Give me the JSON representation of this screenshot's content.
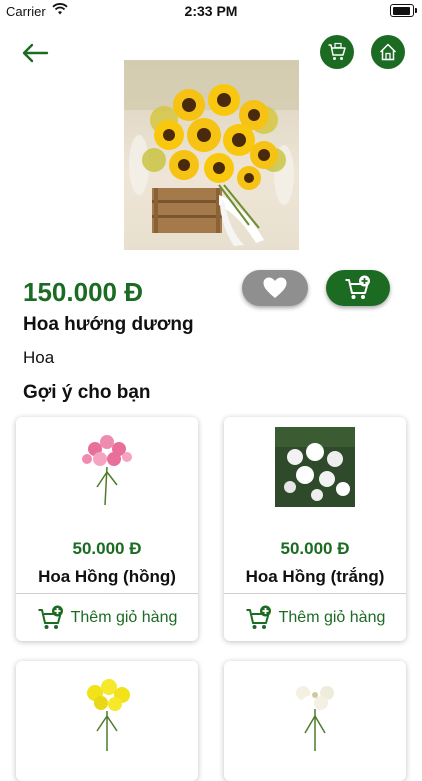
{
  "status_bar": {
    "carrier": "Carrier",
    "time": "2:33 PM"
  },
  "product": {
    "price": "150.000 Đ",
    "name": "Hoa hướng dương",
    "category": "Hoa"
  },
  "suggestions": {
    "title": "Gợi ý cho bạn",
    "items": [
      {
        "price": "50.000 Đ",
        "name": "Hoa Hồng (hồng)",
        "add_label": "Thêm giỏ hàng"
      },
      {
        "price": "50.000 Đ",
        "name": "Hoa Hồng (trắng)",
        "add_label": "Thêm giỏ hàng"
      },
      {
        "price": "",
        "name": "",
        "add_label": ""
      },
      {
        "price": "",
        "name": "",
        "add_label": ""
      }
    ]
  },
  "colors": {
    "accent": "#1b6b23",
    "favorite": "#8f8f8f"
  },
  "icons": [
    "back-arrow-icon",
    "cart-icon",
    "home-icon",
    "heart-icon",
    "add-to-cart-icon"
  ]
}
